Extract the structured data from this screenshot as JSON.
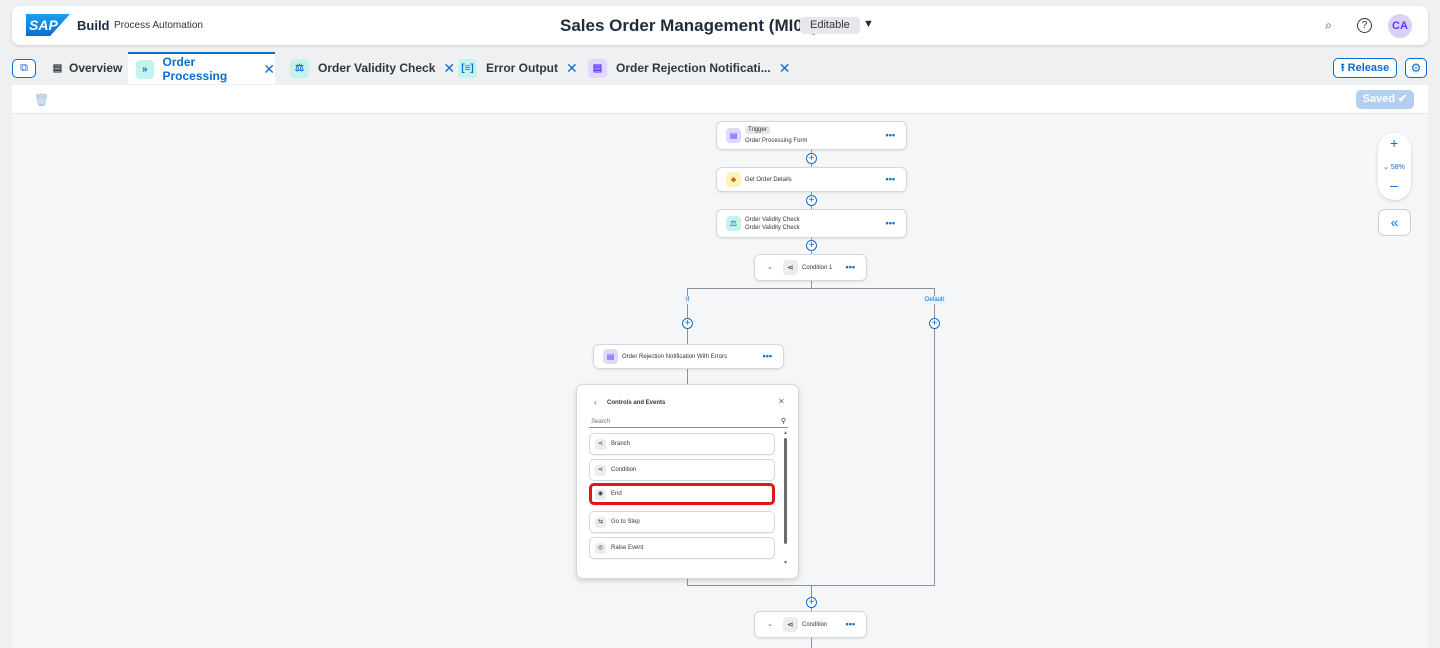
{
  "shell": {
    "logo": "SAP",
    "brand": "Build",
    "brand_sub": "Process Automation",
    "title": "Sales Order Management (MI03)",
    "status": "Editable",
    "avatar": "CA"
  },
  "tabs": [
    {
      "label": "Overview"
    },
    {
      "label": "Order Processing",
      "active": true
    },
    {
      "label": "Order Validity Check"
    },
    {
      "label": "Error Output"
    },
    {
      "label": "Order Rejection Notificati..."
    }
  ],
  "actions": {
    "release": "Release",
    "saved": "Saved"
  },
  "canvas": {
    "nodes": {
      "trigger": {
        "tag": "Trigger",
        "label": "Order Processing Form"
      },
      "get_order": {
        "label": "Get Order Details"
      },
      "validity": {
        "label": "Order Validity Check",
        "sub": "Order Validity Check"
      },
      "condition1": {
        "label": "Condition 1"
      },
      "rejection": {
        "label": "Order Rejection Notification With Errors"
      },
      "condition": {
        "label": "Condition"
      }
    },
    "branch_labels": {
      "if": "If",
      "default": "Default"
    },
    "zoom": "58%"
  },
  "popover": {
    "title": "Controls and Events",
    "search_placeholder": "Search",
    "items": [
      {
        "label": "Branch",
        "icon": "branch-icon"
      },
      {
        "label": "Condition",
        "icon": "condition-icon"
      },
      {
        "label": "End",
        "icon": "end-icon",
        "highlighted": true
      },
      {
        "label": "Go to Step",
        "icon": "goto-icon"
      },
      {
        "label": "Raise Event",
        "icon": "event-icon"
      }
    ]
  },
  "colors": {
    "accent": "#0a6ed1",
    "highlight": "#e0151a",
    "canvas": "#f5f6f7"
  }
}
